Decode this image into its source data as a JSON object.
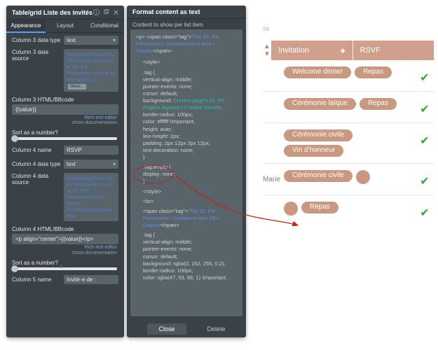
{
  "left_panel": {
    "title": "Table/grid Liste des invités",
    "tabs": [
      "Appearance",
      "Layout",
      "Conditional"
    ],
    "active_tab": 0,
    "rows": {
      "c3_type_label": "Column 3 data type",
      "c3_type_value": "text",
      "c3_src_label": "Column 3 data source",
      "c3_src_prefix": "RepeatingGroup 02. P4 Personnes's List of 02. P4 Personnes:format as text:split by (,)",
      "c3_src_more": "More...",
      "c3_html_label": "Column 3 HTML/BBcode",
      "c3_html_value": "{{value}}",
      "rte": "Rich text editor",
      "doc": "show documentation",
      "sortq": "Sort as a number?",
      "c4_name_label": "Column 4 name",
      "c4_name_value": "RSVP",
      "c4_type_label": "Column 4 data type",
      "c4_type_value": "text",
      "c4_src_label": "Column 4 data source",
      "c4_src_value": "RepeatingGroup 02. P4 Personnes's List of 02. P4 Personnes:each item's RSVP:formatted as text",
      "c4_html_label": "Column 4 HTML/BBcode",
      "c4_html_value": "<p align=\"center\">{{value}}</p>",
      "c5_name_label": "Column 5 name",
      "c5_name_value": "Invité·e de :"
    }
  },
  "right_panel": {
    "title": "Format content as text",
    "subhead": "Content to show per list item",
    "code": {
      "l1a": "<p>   <span class=\"tag\">",
      "l1b": "This 02. P4 Personnes's Invitations:first item's Display",
      "l1c": "</span>",
      "s1": "<style>",
      "s2": ".tag {",
      "s3": "vertical-align: middle;",
      "s4": "pointer-events: none;",
      "s5": "cursor: default;",
      "s6a": "background: ",
      "s6b": "Current page's 02. P0 Projet's Agence's Couleur foncée",
      "s6c": ";",
      "s7": "border-radius: 100px;",
      "s8": "color: #ffffff !important;",
      "s9": "height: auto;",
      "s10": "line-height: 2px;",
      "s11": "padding: 2px 12px 2px 12px;",
      "s12": "text-decoration: none;",
      "s13": "}",
      "e1": ".tag:empty {",
      "e2": "display: none;",
      "e3": "}",
      "st1": "</style>",
      "br": "<br>",
      "l2a": "<span class=\"tag\">",
      "l2b": "This 02. P4 Personnes's Invitations:item #2's Display",
      "l2c": "</span>",
      "t1": ".tag {",
      "t2": "vertical-align: middle;",
      "t3": "pointer-events: none;",
      "t4": "cursor: default;",
      "t5": "background: rgba(0, 162, 255, 0.2);",
      "t6": "border-radius: 100px;",
      "t7": "color: rgba(47, 53, 66, 1) !important;"
    },
    "close": "Close",
    "delete": "Delete"
  },
  "preview": {
    "corner": "ité",
    "col1": "Invitation",
    "col2": "RSVF",
    "row4_lead": "Marie",
    "tags": {
      "r1": [
        "Welcome dinner",
        "Repas"
      ],
      "r2": [
        "Cérémonie laïque",
        "Repas"
      ],
      "r3": [
        "Cérémonie civile",
        "Vin d'honneur"
      ],
      "r4": [
        "Cérémonie civile"
      ],
      "r5": [
        "Repas"
      ]
    }
  }
}
